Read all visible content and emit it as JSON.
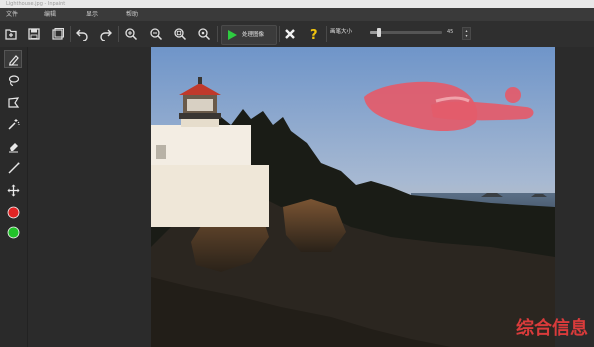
{
  "window": {
    "title": "Lighthouse.jpg - Inpaint"
  },
  "menu": {
    "items": [
      "文件",
      "编辑",
      "显示",
      "帮助"
    ]
  },
  "toolbar": {
    "buttons": [
      "open-icon",
      "save-icon",
      "save-as-icon",
      "undo-icon",
      "redo-icon",
      "zoom-in-icon",
      "zoom-out-icon",
      "zoom-fit-icon",
      "zoom-actual-icon"
    ],
    "process_label": "处理图像",
    "brush_size_label": "画笔大小",
    "brush_size_value": "45",
    "brush_size_fraction": 0.12
  },
  "left_tools": [
    "marker-icon",
    "lasso-icon",
    "polygon-lasso-icon",
    "magic-wand-icon",
    "eraser-icon",
    "line-icon",
    "move-icon",
    "red-color-icon",
    "green-color-icon"
  ],
  "watermark": "综合信息",
  "colors": {
    "mask": "#e35b6a",
    "accent_green": "#2ecc40",
    "help_yellow": "#f1c40f",
    "red_dot": "#e02424",
    "green_dot": "#22c22a"
  }
}
